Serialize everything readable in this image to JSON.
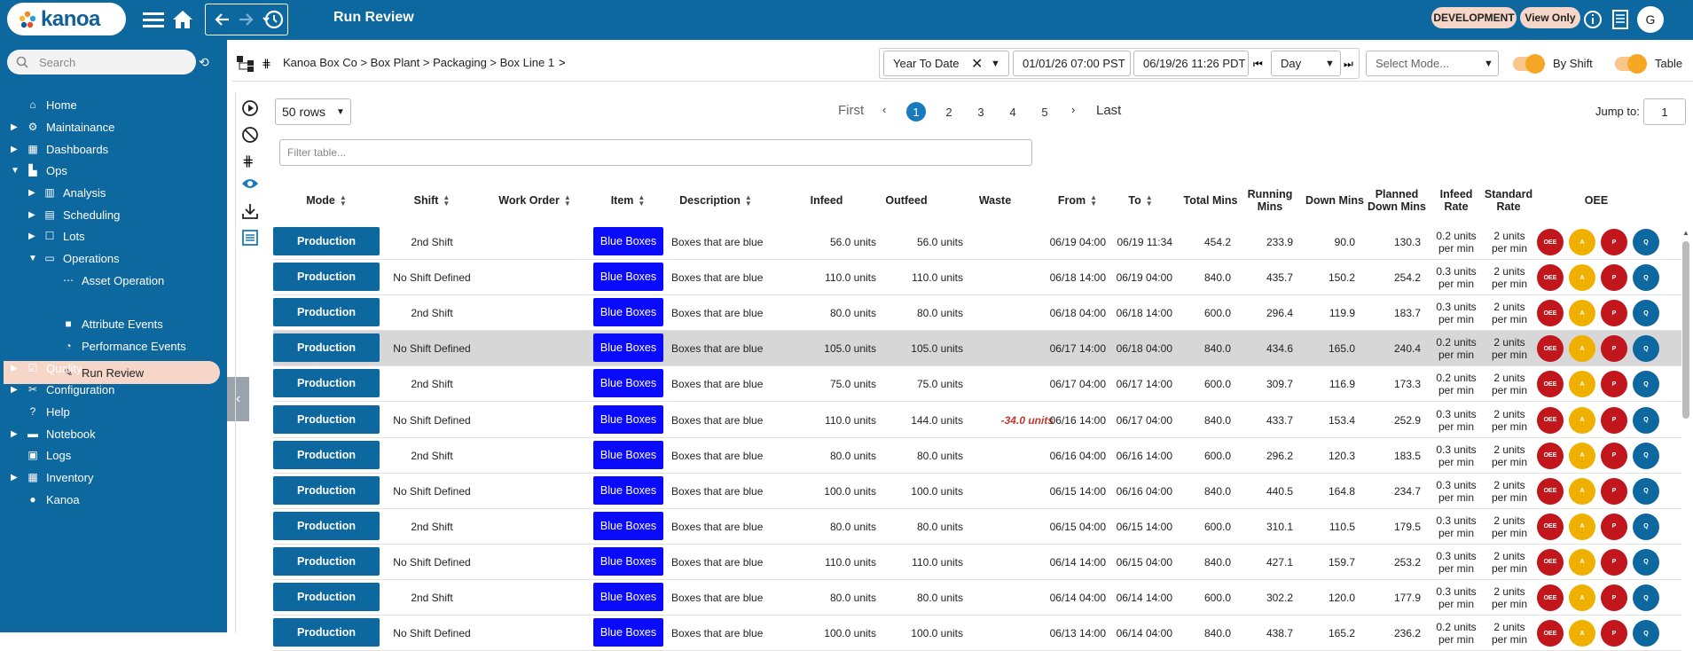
{
  "app": {
    "logo_text": "kanoa",
    "page_title": "Run Review",
    "env_badge": "DEVELOPMENT",
    "view_badge": "View Only",
    "user_initial": "G",
    "colors": {
      "brand": "#0e68a0",
      "accent": "#f6d6c8",
      "item": "#0a0aff"
    }
  },
  "sidebar": {
    "search_placeholder": "Search",
    "items": [
      {
        "label": "Home",
        "icon": "home-icon"
      },
      {
        "label": "Maintainance",
        "icon": "wrench-icon"
      },
      {
        "label": "Dashboards",
        "icon": "dashboard-icon"
      },
      {
        "label": "Ops",
        "icon": "ops-icon"
      },
      {
        "label": "Analysis",
        "icon": "chart-icon"
      },
      {
        "label": "Scheduling",
        "icon": "calendar-icon"
      },
      {
        "label": "Lots",
        "icon": "box-icon"
      },
      {
        "label": "Operations",
        "icon": "folder-icon"
      },
      {
        "label": "Asset Operation",
        "icon": "dots-icon"
      },
      {
        "label": "Run Review",
        "icon": "review-icon"
      },
      {
        "label": "Attribute Events",
        "icon": "square-icon"
      },
      {
        "label": "Performance Events",
        "icon": "gauge-icon"
      },
      {
        "label": "Quality",
        "icon": "quality-icon"
      },
      {
        "label": "Configuration",
        "icon": "tools-icon"
      },
      {
        "label": "Help",
        "icon": "help-icon"
      },
      {
        "label": "Notebook",
        "icon": "folder-icon"
      },
      {
        "label": "Logs",
        "icon": "log-icon"
      },
      {
        "label": "Inventory",
        "icon": "grid-icon"
      },
      {
        "label": "Kanoa",
        "icon": "kanoa-icon"
      }
    ]
  },
  "filters": {
    "breadcrumb": "Kanoa Box Co > Box Plant > Packaging > Box Line 1",
    "breadcrumb_more": ">",
    "range": "Year To Date",
    "start": "01/01/26 07:00 PST",
    "end": "06/19/26 11:26 PDT",
    "interval": "Day",
    "mode_placeholder": "Select Mode...",
    "by_shift": "By Shift",
    "table": "Table"
  },
  "table": {
    "rows_select": "50 rows",
    "pager": {
      "first": "First",
      "last": "Last",
      "pages": [
        "1",
        "2",
        "3",
        "4",
        "5"
      ],
      "current": "1"
    },
    "jump_label": "Jump to:",
    "jump_value": "1",
    "filter_placeholder": "Filter table...",
    "headers": {
      "mode": "Mode",
      "shift": "Shift",
      "work_order": "Work Order",
      "item": "Item",
      "description": "Description",
      "infeed": "Infeed",
      "outfeed": "Outfeed",
      "waste": "Waste",
      "from": "From",
      "to": "To",
      "total_mins": "Total Mins",
      "running_mins": "Running Mins",
      "down_mins": "Down Mins",
      "planned_down_mins": "Planned Down Mins",
      "infeed_rate": "Infeed Rate",
      "standard_rate": "Standard Rate",
      "oee": "OEE"
    },
    "oee_labels": [
      "OEE",
      "A",
      "P",
      "Q"
    ],
    "rows": [
      {
        "mode": "Production",
        "shift": "2nd Shift",
        "work_order": "",
        "item": "Blue Boxes",
        "description": "Boxes that are blue",
        "infeed": "56.0 units",
        "outfeed": "56.0 units",
        "waste": "",
        "from": "06/19 04:00",
        "to": "06/19 11:34",
        "total": "454.2",
        "running": "233.9",
        "down": "90.0",
        "planned": "130.3",
        "infeed_rate": "0.2 units per min",
        "standard_rate": "2 units per min"
      },
      {
        "mode": "Production",
        "shift": "No Shift Defined",
        "work_order": "",
        "item": "Blue Boxes",
        "description": "Boxes that are blue",
        "infeed": "110.0 units",
        "outfeed": "110.0 units",
        "waste": "",
        "from": "06/18 14:00",
        "to": "06/19 04:00",
        "total": "840.0",
        "running": "435.7",
        "down": "150.2",
        "planned": "254.2",
        "infeed_rate": "0.3 units per min",
        "standard_rate": "2 units per min"
      },
      {
        "mode": "Production",
        "shift": "2nd Shift",
        "work_order": "",
        "item": "Blue Boxes",
        "description": "Boxes that are blue",
        "infeed": "80.0 units",
        "outfeed": "80.0 units",
        "waste": "",
        "from": "06/18 04:00",
        "to": "06/18 14:00",
        "total": "600.0",
        "running": "296.4",
        "down": "119.9",
        "planned": "183.7",
        "infeed_rate": "0.3 units per min",
        "standard_rate": "2 units per min"
      },
      {
        "mode": "Production",
        "shift": "No Shift Defined",
        "work_order": "",
        "item": "Blue Boxes",
        "description": "Boxes that are blue",
        "infeed": "105.0 units",
        "outfeed": "105.0 units",
        "waste": "",
        "from": "06/17 14:00",
        "to": "06/18 04:00",
        "total": "840.0",
        "running": "434.6",
        "down": "165.0",
        "planned": "240.4",
        "infeed_rate": "0.2 units per min",
        "standard_rate": "2 units per min"
      },
      {
        "mode": "Production",
        "shift": "2nd Shift",
        "work_order": "",
        "item": "Blue Boxes",
        "description": "Boxes that are blue",
        "infeed": "75.0 units",
        "outfeed": "75.0 units",
        "waste": "",
        "from": "06/17 04:00",
        "to": "06/17 14:00",
        "total": "600.0",
        "running": "309.7",
        "down": "116.9",
        "planned": "173.3",
        "infeed_rate": "0.2 units per min",
        "standard_rate": "2 units per min"
      },
      {
        "mode": "Production",
        "shift": "No Shift Defined",
        "work_order": "",
        "item": "Blue Boxes",
        "description": "Boxes that are blue",
        "infeed": "110.0 units",
        "outfeed": "144.0 units",
        "waste": "-34.0 units",
        "from": "06/16 14:00",
        "to": "06/17 04:00",
        "total": "840.0",
        "running": "433.7",
        "down": "153.4",
        "planned": "252.9",
        "infeed_rate": "0.3 units per min",
        "standard_rate": "2 units per min"
      },
      {
        "mode": "Production",
        "shift": "2nd Shift",
        "work_order": "",
        "item": "Blue Boxes",
        "description": "Boxes that are blue",
        "infeed": "80.0 units",
        "outfeed": "80.0 units",
        "waste": "",
        "from": "06/16 04:00",
        "to": "06/16 14:00",
        "total": "600.0",
        "running": "296.2",
        "down": "120.3",
        "planned": "183.5",
        "infeed_rate": "0.3 units per min",
        "standard_rate": "2 units per min"
      },
      {
        "mode": "Production",
        "shift": "No Shift Defined",
        "work_order": "",
        "item": "Blue Boxes",
        "description": "Boxes that are blue",
        "infeed": "100.0 units",
        "outfeed": "100.0 units",
        "waste": "",
        "from": "06/15 14:00",
        "to": "06/16 04:00",
        "total": "840.0",
        "running": "440.5",
        "down": "164.8",
        "planned": "234.7",
        "infeed_rate": "0.3 units per min",
        "standard_rate": "2 units per min"
      },
      {
        "mode": "Production",
        "shift": "2nd Shift",
        "work_order": "",
        "item": "Blue Boxes",
        "description": "Boxes that are blue",
        "infeed": "80.0 units",
        "outfeed": "80.0 units",
        "waste": "",
        "from": "06/15 04:00",
        "to": "06/15 14:00",
        "total": "600.0",
        "running": "310.1",
        "down": "110.5",
        "planned": "179.5",
        "infeed_rate": "0.3 units per min",
        "standard_rate": "2 units per min"
      },
      {
        "mode": "Production",
        "shift": "No Shift Defined",
        "work_order": "",
        "item": "Blue Boxes",
        "description": "Boxes that are blue",
        "infeed": "110.0 units",
        "outfeed": "110.0 units",
        "waste": "",
        "from": "06/14 14:00",
        "to": "06/15 04:00",
        "total": "840.0",
        "running": "427.1",
        "down": "159.7",
        "planned": "253.2",
        "infeed_rate": "0.3 units per min",
        "standard_rate": "2 units per min"
      },
      {
        "mode": "Production",
        "shift": "2nd Shift",
        "work_order": "",
        "item": "Blue Boxes",
        "description": "Boxes that are blue",
        "infeed": "80.0 units",
        "outfeed": "80.0 units",
        "waste": "",
        "from": "06/14 04:00",
        "to": "06/14 14:00",
        "total": "600.0",
        "running": "302.2",
        "down": "120.0",
        "planned": "177.9",
        "infeed_rate": "0.3 units per min",
        "standard_rate": "2 units per min"
      },
      {
        "mode": "Production",
        "shift": "No Shift Defined",
        "work_order": "",
        "item": "Blue Boxes",
        "description": "Boxes that are blue",
        "infeed": "100.0 units",
        "outfeed": "100.0 units",
        "waste": "",
        "from": "06/13 14:00",
        "to": "06/14 04:00",
        "total": "840.0",
        "running": "438.7",
        "down": "165.2",
        "planned": "236.2",
        "infeed_rate": "0.2 units per min",
        "standard_rate": "2 units per min"
      }
    ]
  }
}
